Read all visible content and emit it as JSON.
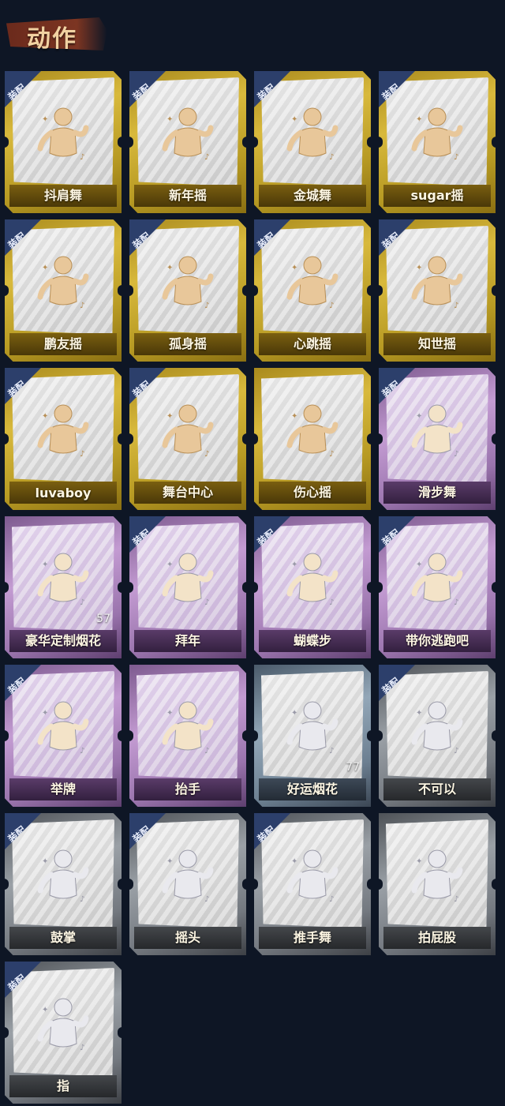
{
  "header": {
    "title": "动作"
  },
  "equip_label": "装配",
  "cards": [
    {
      "name": "抖肩舞",
      "tier": "gold",
      "equipped": true,
      "icon": "dancer-shrug-icon"
    },
    {
      "name": "新年摇",
      "tier": "gold",
      "equipped": true,
      "icon": "dancer-wave-icon"
    },
    {
      "name": "金城舞",
      "tier": "gold",
      "equipped": true,
      "icon": "dancer-hand-up-icon"
    },
    {
      "name": "sugar摇",
      "tier": "gold",
      "equipped": true,
      "icon": "dancer-music-icon"
    },
    {
      "name": "鹏友摇",
      "tier": "gold",
      "equipped": true,
      "icon": "dancer-point-icon"
    },
    {
      "name": "孤身摇",
      "tier": "gold",
      "equipped": true,
      "icon": "dancer-hug-icon"
    },
    {
      "name": "心跳摇",
      "tier": "gold",
      "equipped": true,
      "icon": "dancer-raise-icon"
    },
    {
      "name": "知世摇",
      "tier": "gold",
      "equipped": true,
      "icon": "dancer-swing-icon"
    },
    {
      "name": "luvaboy",
      "tier": "gold",
      "equipped": true,
      "icon": "dancer-cross-icon"
    },
    {
      "name": "舞台中心",
      "tier": "gold",
      "equipped": true,
      "icon": "dancer-sparkle-icon"
    },
    {
      "name": "伤心摇",
      "tier": "gold",
      "equipped": false,
      "icon": "dancer-heart-icon"
    },
    {
      "name": "滑步舞",
      "tier": "purple",
      "equipped": true,
      "icon": "dancer-slide-icon"
    },
    {
      "name": "豪华定制烟花",
      "tier": "purple",
      "equipped": false,
      "icon": "fireworks-box-icon",
      "count": "57"
    },
    {
      "name": "拜年",
      "tier": "purple",
      "equipped": true,
      "icon": "figure-bow-icon"
    },
    {
      "name": "蝴蝶步",
      "tier": "purple",
      "equipped": true,
      "icon": "dancer-dab-icon"
    },
    {
      "name": "带你逃跑吧",
      "tier": "purple",
      "equipped": true,
      "icon": "dancer-run-icon"
    },
    {
      "name": "举牌",
      "tier": "purple",
      "equipped": true,
      "icon": "sign-hold-icon"
    },
    {
      "name": "抬手",
      "tier": "purple",
      "equipped": false,
      "icon": "hand-raise-icon"
    },
    {
      "name": "好运烟花",
      "tier": "blue",
      "equipped": false,
      "icon": "firework-can-icon",
      "count": "77"
    },
    {
      "name": "不可以",
      "tier": "gray",
      "equipped": true,
      "icon": "finger-wag-icon"
    },
    {
      "name": "鼓掌",
      "tier": "gray",
      "equipped": true,
      "icon": "clap-icon"
    },
    {
      "name": "摇头",
      "tier": "gray",
      "equipped": true,
      "icon": "head-shake-icon"
    },
    {
      "name": "推手舞",
      "tier": "gray",
      "equipped": true,
      "icon": "push-dance-icon"
    },
    {
      "name": "拍屁股",
      "tier": "gray",
      "equipped": false,
      "icon": "butt-slap-icon"
    },
    {
      "name": "指",
      "tier": "gray",
      "equipped": true,
      "icon": "point-icon"
    }
  ]
}
